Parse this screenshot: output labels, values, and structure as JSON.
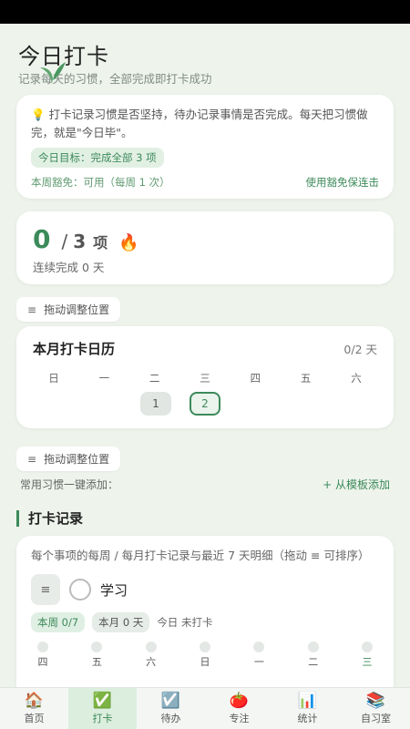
{
  "header": {
    "title": "今日打卡",
    "subtitle": "记录每天的习惯，全部完成即打卡成功"
  },
  "intro": {
    "text": "打卡记录习惯是否坚持，待办记录事情是否完成。每天把习惯做完，就是\"今日毕\"。",
    "goal": "今日目标：完成全部 3 项",
    "exempt_status": "本周豁免：可用（每周 1 次）",
    "exempt_action": "使用豁免保连击"
  },
  "progress": {
    "done": "0",
    "separator": "/",
    "total": "3",
    "unit": "项",
    "streak": "连续完成 0 天"
  },
  "drag_label": "拖动调整位置",
  "calendar": {
    "title": "本月打卡日历",
    "count": "0/2 天",
    "weekdays": [
      "日",
      "一",
      "二",
      "三",
      "四",
      "五",
      "六"
    ],
    "days": [
      "1",
      "2"
    ],
    "today": "2"
  },
  "quick_add": {
    "label": "常用习惯一键添加：",
    "template_link": "+ 从模板添加"
  },
  "records": {
    "title": "打卡记录",
    "description": "每个事项的每周 / 每月打卡记录与最近 7 天明细（拖动 ≡ 可排序）",
    "habit": {
      "name": "学习",
      "week": "本周 0/7",
      "month": "本月 0 天",
      "today": "今日 未打卡",
      "days": [
        "四",
        "五",
        "六",
        "日",
        "一",
        "二",
        "三"
      ]
    }
  },
  "tabbar": {
    "items": [
      {
        "label": "首页",
        "icon": "home-icon"
      },
      {
        "label": "打卡",
        "icon": "check-icon"
      },
      {
        "label": "待办",
        "icon": "todo-icon"
      },
      {
        "label": "专注",
        "icon": "tomato-icon"
      },
      {
        "label": "统计",
        "icon": "stats-icon"
      },
      {
        "label": "自习室",
        "icon": "books-icon"
      }
    ],
    "active": "打卡"
  },
  "colors": {
    "accent": "#3c8a5a",
    "background": "#eef4ec"
  }
}
